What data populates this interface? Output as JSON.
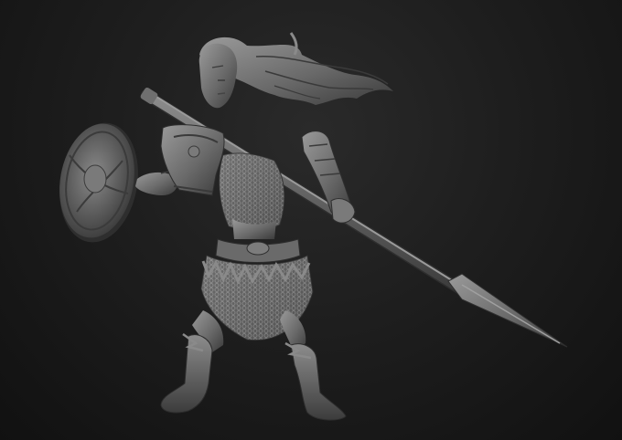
{
  "scene": {
    "subject": "warrior-woman-sculpt",
    "render_style": "clay-render",
    "colors": {
      "background_top": "#2c2c2c",
      "background_bottom": "#121212",
      "clay_light": "#8a8a8a",
      "clay_mid": "#5e5e5e",
      "clay_dark": "#2f2f2f"
    },
    "parts": [
      "head-with-flowing-hair",
      "spear",
      "round-shield",
      "shoulder-pauldron",
      "right-forearm-bracer",
      "chainmail-torso",
      "belt",
      "fur-skirt",
      "left-leg-boot",
      "right-leg-boot"
    ]
  }
}
